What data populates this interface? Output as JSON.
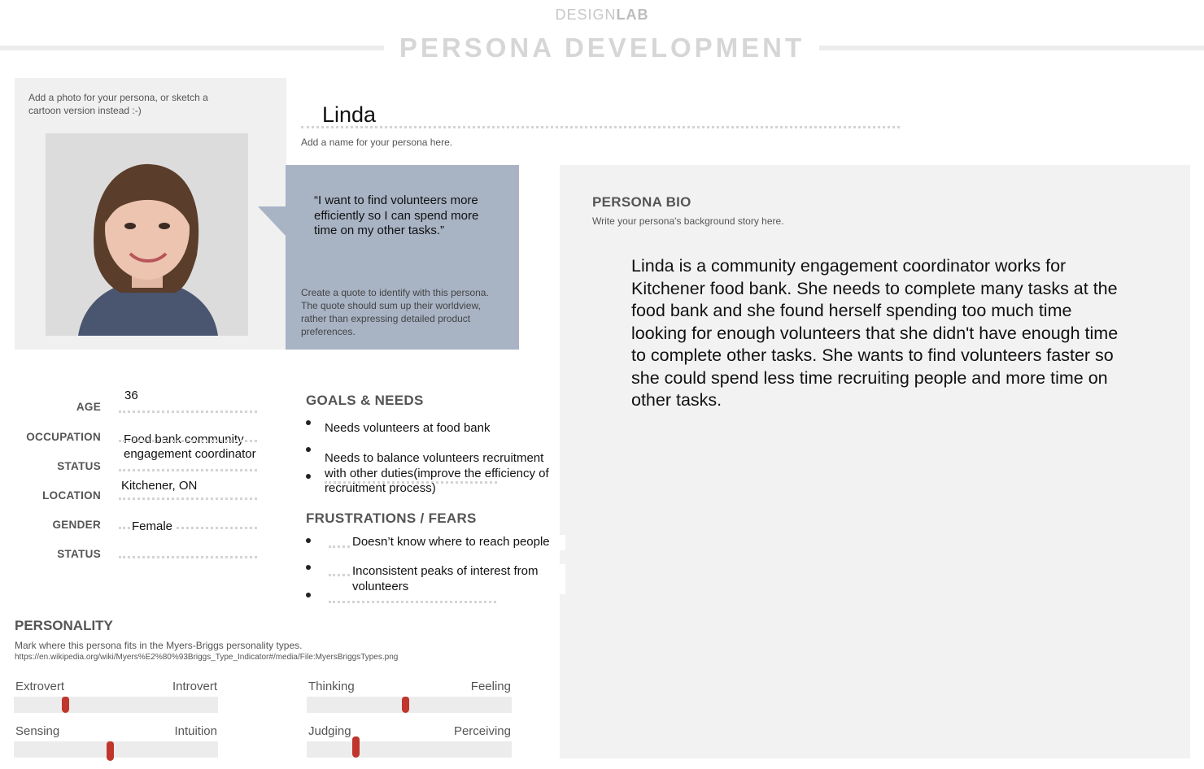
{
  "header": {
    "brand_light": "DESIGN",
    "brand_bold": "LAB",
    "title": "PERSONA DEVELOPMENT"
  },
  "photo": {
    "hint": "Add a photo for your persona, or sketch a cartoon version instead :-)"
  },
  "name": {
    "value": "Linda",
    "hint": "Add a name for your persona here."
  },
  "quote": {
    "text": "“I want to find volunteers more efficiently so I can spend more time on my other tasks.”",
    "hint": "Create a quote to identify with this persona. The quote should sum up their worldview, rather than expressing detailed product preferences."
  },
  "bio": {
    "heading": "PERSONA BIO",
    "hint": "Write your persona's background story here.",
    "text": "Linda is a community engagement coordinator works for Kitchener food bank. She needs to complete many tasks at the food bank and she found herself spending too much time looking for enough volunteers that she didn't have enough time to complete other tasks. She wants to find volunteers faster so she could spend less time recruiting people and more time on other tasks."
  },
  "fields": {
    "age_label": "AGE",
    "age_value": "36",
    "occupation_label": "OCCUPATION",
    "occupation_value_1": "Food bank community",
    "occupation_value_2": "engagement coordinator",
    "status_label_1": "STATUS",
    "location_label": "LOCATION",
    "location_value": "Kitchener, ON",
    "gender_label": "GENDER",
    "gender_value": "Female",
    "status_label_2": "STATUS"
  },
  "goals": {
    "heading": "GOALS & NEEDS",
    "items": [
      "Needs volunteers at food bank",
      "Needs to balance volunteers recruitment with other duties(improve the efficiency of recruitment process)"
    ]
  },
  "frustrations": {
    "heading": "FRUSTRATIONS / FEARS",
    "items": [
      "Doesn’t know where to reach people",
      "Inconsistent peaks of interest from volunteers"
    ]
  },
  "personality": {
    "heading": "PERSONALITY",
    "hint": "Mark where this persona fits in the Myers-Briggs personality types.",
    "url": "https://en.wikipedia.org/wiki/Myers%E2%80%93Briggs_Type_Indicator#/media/File:MyersBriggsTypes.png",
    "scales": [
      {
        "left": "Extrovert",
        "right": "Introvert",
        "position": 0.25
      },
      {
        "left": "Thinking",
        "right": "Feeling",
        "position": 0.48
      },
      {
        "left": "Sensing",
        "right": "Intuition",
        "position": 0.47
      },
      {
        "left": "Judging",
        "right": "Perceiving",
        "position": 0.24
      }
    ],
    "marker_color": "#c0362c"
  }
}
